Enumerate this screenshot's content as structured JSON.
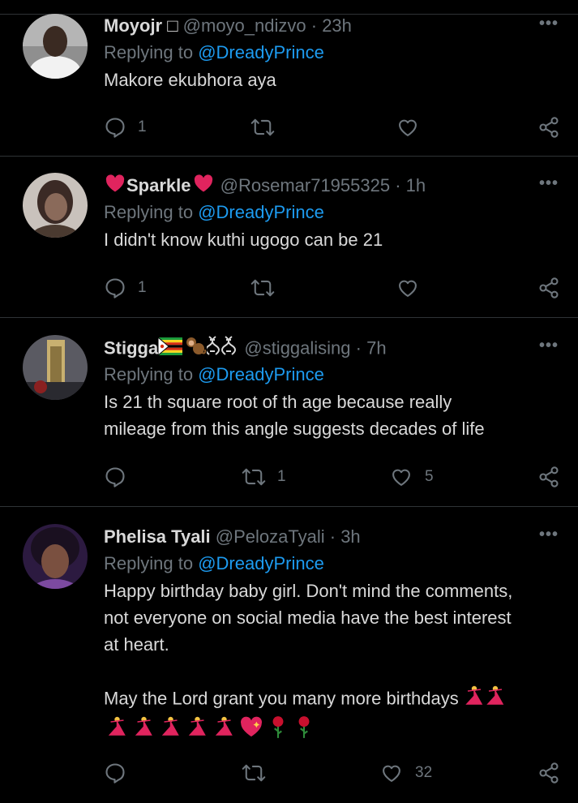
{
  "reply_prefix": "Replying to",
  "tweets": [
    {
      "name": "Moyojr ",
      "name_glyph": "□",
      "handle": "@moyo_ndizvo",
      "time": "23h",
      "reply_to": "@DreadyPrince",
      "text": "Makore ekubhora aya",
      "replies": "1",
      "retweets": "",
      "likes": "",
      "avatar_colors": [
        "#f2f2f2",
        "#3a2a22",
        "#9a9a9a"
      ]
    },
    {
      "name": "Sparkle",
      "handle": "@Rosemar71955325",
      "time": "1h",
      "reply_to": "@DreadyPrince",
      "text": "I didn't know kuthi ugogo can be 21",
      "replies": "1",
      "retweets": "",
      "likes": "",
      "avatar_colors": [
        "#c9c2bc",
        "#3b2a25",
        "#8a6a5a"
      ]
    },
    {
      "name": "Stigga",
      "handle": "@stiggalising",
      "time": "7h",
      "reply_to": "@DreadyPrince",
      "text": "Is 21 th square root of th age because really\nmileage from this angle suggests decades of life",
      "replies": "",
      "retweets": "1",
      "likes": "5",
      "avatar_colors": [
        "#6a6a72",
        "#c8b070",
        "#2a2a30"
      ]
    },
    {
      "name": "Phelisa Tyali",
      "handle": "@PelozaTyali",
      "time": "3h",
      "reply_to": "@DreadyPrince",
      "text": "Happy birthday baby girl. Don't mind the comments,\nnot everyone on social media have the best interest\nat heart.\n\nMay the Lord grant you many more birthdays",
      "replies": "",
      "retweets": "",
      "likes": "32",
      "avatar_colors": [
        "#2c1a40",
        "#5a3a32",
        "#7c4aa0"
      ]
    }
  ],
  "accent": "#1d9bf0",
  "icons": [
    "reply-icon",
    "retweet-icon",
    "like-icon",
    "share-icon",
    "more-icon"
  ]
}
